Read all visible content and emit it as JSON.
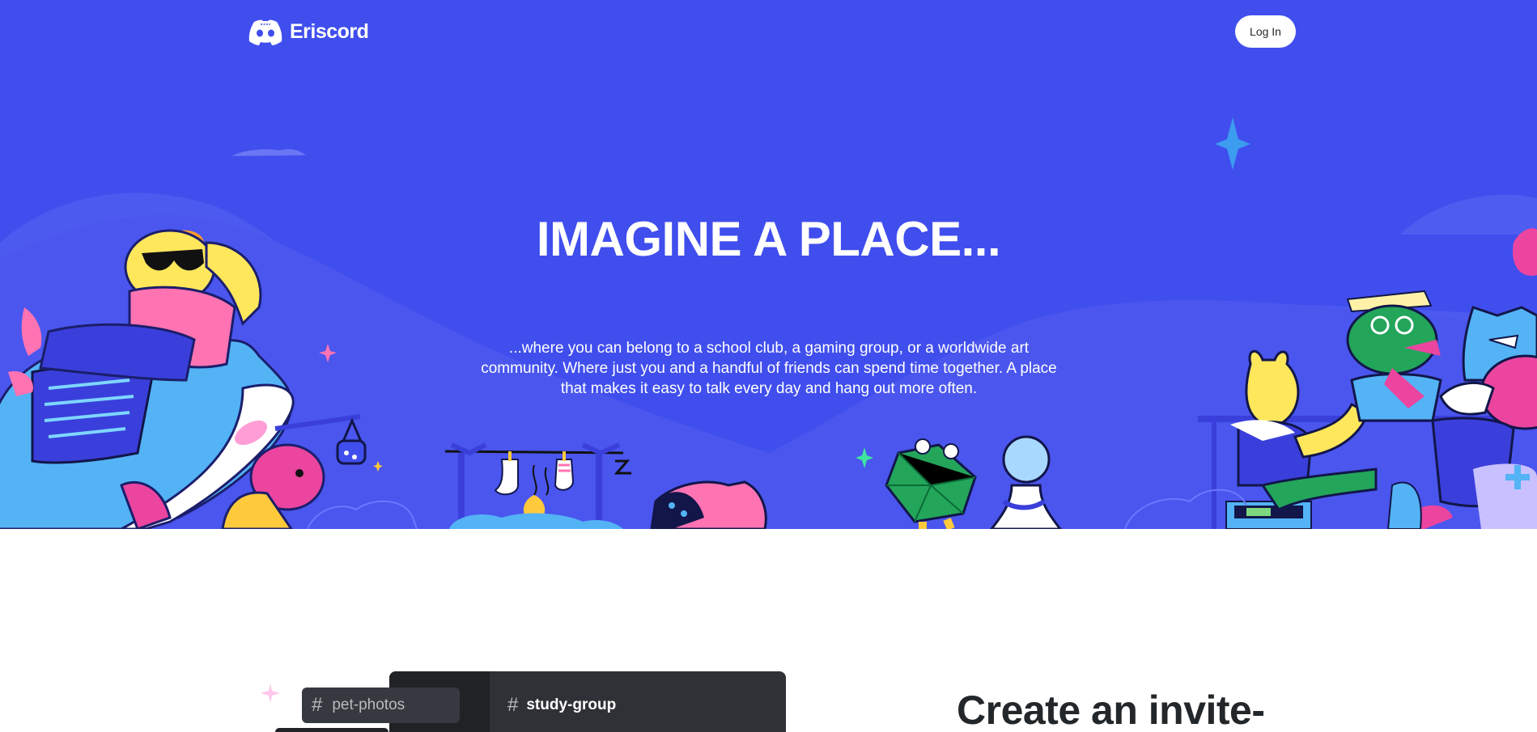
{
  "brand": {
    "name": "Eriscord",
    "icon": "controller-icon"
  },
  "nav": {
    "login_label": "Log In"
  },
  "hero": {
    "title": "IMAGINE A PLACE...",
    "description_lines": [
      "...where you can belong to a school club, a gaming group, or a worldwide art",
      "community. Where just you and a handful of friends can spend time together. A place",
      "that makes it easy to talk every day and hang out more often."
    ]
  },
  "feature": {
    "channel_pill": "pet-photos",
    "channel_header": "study-group",
    "title": "Create an invite-"
  },
  "colors": {
    "blurple": "#404eed",
    "hill": "#5865f2",
    "dark": "#23272a",
    "panel": "#2f3136"
  }
}
